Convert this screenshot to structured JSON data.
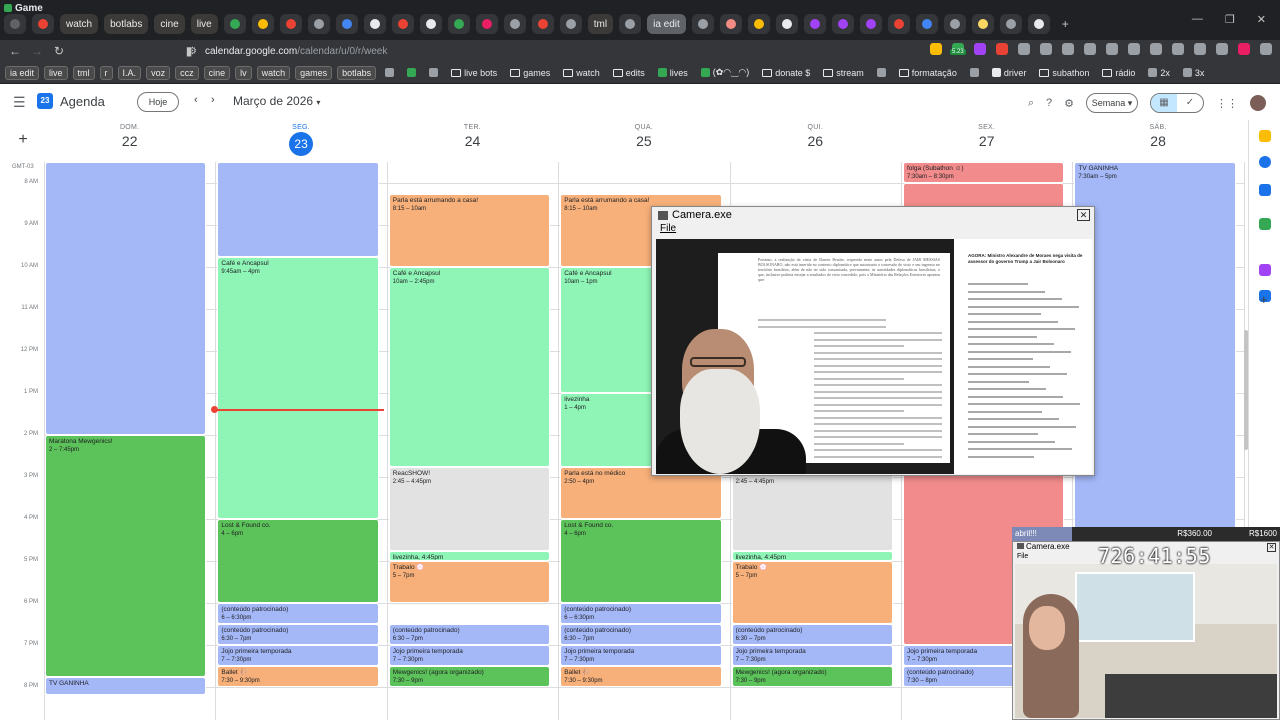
{
  "browser": {
    "window_title": "Game",
    "tabs": [
      {
        "label": "",
        "color": "#5f6368"
      },
      {
        "label": "",
        "color": "#ea4335"
      },
      {
        "label": "watch",
        "color": "#e8eaed"
      },
      {
        "label": "botlabs",
        "color": "#e8eaed"
      },
      {
        "label": "cine",
        "color": "#e8eaed"
      },
      {
        "label": "live",
        "color": "#e8eaed"
      },
      {
        "label": "",
        "color": "#34a853"
      },
      {
        "label": "",
        "color": "#fbbc04"
      },
      {
        "label": "",
        "color": "#ea4335"
      },
      {
        "label": "",
        "color": "#9aa0a6"
      },
      {
        "label": "",
        "color": "#4285f4"
      },
      {
        "label": "",
        "color": "#e8eaed"
      },
      {
        "label": "",
        "color": "#ea4335"
      },
      {
        "label": "",
        "color": "#e8eaed"
      },
      {
        "label": "",
        "color": "#34a853"
      },
      {
        "label": "",
        "color": "#e91e63"
      },
      {
        "label": "",
        "color": "#9aa0a6"
      },
      {
        "label": "",
        "color": "#ea4335"
      },
      {
        "label": "",
        "color": "#9aa0a6"
      },
      {
        "label": "tml",
        "color": "#e8eaed"
      },
      {
        "label": "",
        "color": "#9aa0a6"
      },
      {
        "label": "ia edit",
        "color": "#e8eaed"
      },
      {
        "label": "",
        "color": "#9aa0a6"
      },
      {
        "label": "",
        "color": "#f28b82"
      },
      {
        "label": "",
        "color": "#fbbc04"
      },
      {
        "label": "",
        "color": "#e8eaed"
      },
      {
        "label": "",
        "color": "#a142f4"
      },
      {
        "label": "",
        "color": "#a142f4"
      },
      {
        "label": "",
        "color": "#a142f4"
      },
      {
        "label": "",
        "color": "#ea4335"
      },
      {
        "label": "",
        "color": "#4285f4"
      },
      {
        "label": "",
        "color": "#9aa0a6"
      },
      {
        "label": "",
        "color": "#fdd663"
      },
      {
        "label": "",
        "color": "#9aa0a6"
      },
      {
        "label": "",
        "color": "#e8eaed"
      }
    ],
    "new_tab": "+",
    "url_host": "calendar.google.com",
    "url_path": "/calendar/u/0/r/week",
    "extension_badge": "5.23",
    "window_controls": [
      "—",
      "❐",
      "✕"
    ],
    "bookmarks": [
      {
        "label": "ia edit",
        "boxed": true
      },
      {
        "label": "live",
        "boxed": true
      },
      {
        "label": "tml",
        "boxed": true
      },
      {
        "label": "r",
        "boxed": true
      },
      {
        "label": "I.A.",
        "boxed": true
      },
      {
        "label": "voz",
        "boxed": true
      },
      {
        "label": "ccz",
        "boxed": true
      },
      {
        "label": "cine",
        "boxed": true
      },
      {
        "label": "lv",
        "boxed": true
      },
      {
        "label": "watch",
        "boxed": true
      },
      {
        "label": "games",
        "boxed": true
      },
      {
        "label": "botlabs",
        "boxed": true
      },
      {
        "label": "",
        "boxed": false,
        "icon": "grid-icon"
      },
      {
        "label": "",
        "boxed": false,
        "icon": "sheet-icon"
      },
      {
        "label": "",
        "boxed": false,
        "icon": "globe-icon"
      },
      {
        "label": "live bots",
        "boxed": false,
        "icon": "folder-icon"
      },
      {
        "label": "games",
        "boxed": false,
        "icon": "folder-icon"
      },
      {
        "label": "watch",
        "boxed": false,
        "icon": "folder-icon"
      },
      {
        "label": "edits",
        "boxed": false,
        "icon": "folder-icon"
      },
      {
        "label": "lives",
        "boxed": false,
        "icon": "sheet-icon"
      },
      {
        "label": "(✿◠‿◠)",
        "boxed": false,
        "icon": "leaf-icon"
      },
      {
        "label": "donate $",
        "boxed": false,
        "icon": "folder-icon"
      },
      {
        "label": "stream",
        "boxed": false,
        "icon": "folder-icon"
      },
      {
        "label": "",
        "boxed": false,
        "icon": "screen-icon"
      },
      {
        "label": "formatação",
        "boxed": false,
        "icon": "folder-icon"
      },
      {
        "label": "",
        "boxed": false,
        "icon": "globe-icon"
      },
      {
        "label": "driver",
        "boxed": false,
        "icon": "doc-icon"
      },
      {
        "label": "subathon",
        "boxed": false,
        "icon": "folder-icon"
      },
      {
        "label": "rádio",
        "boxed": false,
        "icon": "folder-icon"
      },
      {
        "label": "2x",
        "boxed": false,
        "icon": "globe-icon"
      },
      {
        "label": "3x",
        "boxed": false,
        "icon": "globe-icon"
      }
    ]
  },
  "calendar": {
    "app_title": "Agenda",
    "logo_text": "23",
    "today_button": "Hoje",
    "month_label": "Março de 2026",
    "view_button": "Semana",
    "timezone": "GMT-03",
    "days": [
      {
        "dow": "DOM.",
        "num": "22",
        "today": false
      },
      {
        "dow": "SEG.",
        "num": "23",
        "today": true
      },
      {
        "dow": "TER.",
        "num": "24",
        "today": false
      },
      {
        "dow": "QUA.",
        "num": "25",
        "today": false
      },
      {
        "dow": "QUI.",
        "num": "26",
        "today": false
      },
      {
        "dow": "SEX.",
        "num": "27",
        "today": false
      },
      {
        "dow": "SÁB.",
        "num": "28",
        "today": false
      }
    ],
    "hours": [
      "8 AM",
      "9 AM",
      "10 AM",
      "11 AM",
      "12 PM",
      "1 PM",
      "2 PM",
      "3 PM",
      "4 PM",
      "5 PM",
      "6 PM",
      "7 PM",
      "8 PM"
    ],
    "events": [
      {
        "day": 0,
        "start": 7.5,
        "end": 14.0,
        "title": "",
        "time": "",
        "color": "blue"
      },
      {
        "day": 0,
        "start": 14.0,
        "end": 19.75,
        "title": "Maratona Mewgenics!",
        "time": "2 – 7:45pm",
        "color": "dgreen"
      },
      {
        "day": 0,
        "start": 19.75,
        "end": 20.2,
        "title": "TV GANINHA",
        "time": "",
        "color": "blue"
      },
      {
        "day": 1,
        "start": 7.5,
        "end": 9.75,
        "title": "",
        "time": "",
        "color": "blue"
      },
      {
        "day": 1,
        "start": 9.75,
        "end": 16.0,
        "title": "Café e Ancapsul",
        "time": "9:45am – 4pm",
        "color": "mint"
      },
      {
        "day": 1,
        "start": 16.0,
        "end": 18.0,
        "title": "Lost & Found co.",
        "time": "4 – 6pm",
        "color": "dgreen"
      },
      {
        "day": 1,
        "start": 18.0,
        "end": 18.5,
        "title": "(conteúdo patrocinado)",
        "time": "6 – 6:30pm",
        "color": "blue"
      },
      {
        "day": 1,
        "start": 18.5,
        "end": 19.0,
        "title": "(conteúdo patrocinado)",
        "time": "6:30 – 7pm",
        "color": "blue"
      },
      {
        "day": 1,
        "start": 19.0,
        "end": 19.5,
        "title": "Jojo primeira temporada",
        "time": "7 – 7:30pm",
        "color": "blue"
      },
      {
        "day": 1,
        "start": 19.5,
        "end": 20.0,
        "title": "Ballet 🩰",
        "time": "7:30 – 9:30pm",
        "color": "orange"
      },
      {
        "day": 2,
        "start": 8.25,
        "end": 10.0,
        "title": "Parla está arrumando a casa!",
        "time": "8:15 – 10am",
        "color": "orange"
      },
      {
        "day": 2,
        "start": 10.0,
        "end": 14.75,
        "title": "Café e Ancapsul",
        "time": "10am – 2:45pm",
        "color": "mint"
      },
      {
        "day": 2,
        "start": 14.75,
        "end": 16.75,
        "title": "ReacSHOW!",
        "time": "2:45 – 4:45pm",
        "color": "gray"
      },
      {
        "day": 2,
        "start": 16.75,
        "end": 17.0,
        "title": "livezinha, 4:45pm",
        "time": "",
        "color": "mint"
      },
      {
        "day": 2,
        "start": 17.0,
        "end": 18.0,
        "title": "Trabalo 💮",
        "time": "5 – 7pm",
        "color": "orange"
      },
      {
        "day": 2,
        "start": 18.5,
        "end": 19.0,
        "title": "(conteúdo patrocinado)",
        "time": "6:30 – 7pm",
        "color": "blue"
      },
      {
        "day": 2,
        "start": 19.0,
        "end": 19.5,
        "title": "Jojo primeira temporada",
        "time": "7 – 7:30pm",
        "color": "blue"
      },
      {
        "day": 2,
        "start": 19.5,
        "end": 20.0,
        "title": "Mewgenics! (agora organizado)",
        "time": "7:30 – 9pm",
        "color": "dgreen"
      },
      {
        "day": 3,
        "start": 8.25,
        "end": 10.0,
        "title": "Parla está arrumando a casa!",
        "time": "8:15 – 10am",
        "color": "orange"
      },
      {
        "day": 3,
        "start": 10.0,
        "end": 13.0,
        "title": "Café e Ancapsul",
        "time": "10am – 1pm",
        "color": "mint"
      },
      {
        "day": 3,
        "start": 13.0,
        "end": 14.75,
        "title": "livezinha",
        "time": "1 – 4pm",
        "color": "mint"
      },
      {
        "day": 3,
        "start": 14.75,
        "end": 16.0,
        "title": "Parla está no médico",
        "time": "2:50 – 4pm",
        "color": "orange"
      },
      {
        "day": 3,
        "start": 16.0,
        "end": 18.0,
        "title": "Lost & Found co.",
        "time": "4 – 6pm",
        "color": "dgreen"
      },
      {
        "day": 3,
        "start": 18.0,
        "end": 18.5,
        "title": "(conteúdo patrocinado)",
        "time": "6 – 6:30pm",
        "color": "blue"
      },
      {
        "day": 3,
        "start": 18.5,
        "end": 19.0,
        "title": "(conteúdo patrocinado)",
        "time": "6:30 – 7pm",
        "color": "blue"
      },
      {
        "day": 3,
        "start": 19.0,
        "end": 19.5,
        "title": "Jojo primeira temporada",
        "time": "7 – 7:30pm",
        "color": "blue"
      },
      {
        "day": 3,
        "start": 19.5,
        "end": 20.0,
        "title": "Ballet 🩰",
        "time": "7:30 – 9:30pm",
        "color": "orange"
      },
      {
        "day": 4,
        "start": 14.75,
        "end": 16.75,
        "title": "ReacSHOW!",
        "time": "2:45 – 4:45pm",
        "color": "gray"
      },
      {
        "day": 4,
        "start": 16.75,
        "end": 17.0,
        "title": "livezinha, 4:45pm",
        "time": "",
        "color": "mint"
      },
      {
        "day": 4,
        "start": 17.0,
        "end": 18.5,
        "title": "Trabalo 💮",
        "time": "5 – 7pm",
        "color": "orange"
      },
      {
        "day": 4,
        "start": 18.5,
        "end": 19.0,
        "title": "(conteúdo patrocinado)",
        "time": "6:30 – 7pm",
        "color": "blue"
      },
      {
        "day": 4,
        "start": 19.0,
        "end": 19.5,
        "title": "Jojo primeira temporada",
        "time": "7 – 7:30pm",
        "color": "blue"
      },
      {
        "day": 4,
        "start": 19.5,
        "end": 20.0,
        "title": "Mewgenics! (agora organizado)",
        "time": "7:30 – 9pm",
        "color": "dgreen"
      },
      {
        "day": 5,
        "start": 7.5,
        "end": 8.0,
        "title": "folga (Subathon ☺)",
        "time": "7:30am – 8:30pm",
        "color": "red"
      },
      {
        "day": 5,
        "start": 8.0,
        "end": 19.0,
        "title": "",
        "time": "",
        "color": "red"
      },
      {
        "day": 5,
        "start": 19.0,
        "end": 19.5,
        "title": "Jojo primeira temporada",
        "time": "7 – 7:30pm",
        "color": "blue"
      },
      {
        "day": 5,
        "start": 19.5,
        "end": 20.0,
        "title": "(conteúdo patrocinado)",
        "time": "7:30 – 8pm",
        "color": "blue"
      },
      {
        "day": 6,
        "start": 7.5,
        "end": 16.5,
        "title": "TV GANINHA",
        "time": "7:30am – 5pm",
        "color": "blue"
      }
    ]
  },
  "camera_window": {
    "title": "Camera.exe",
    "menu_file": "File",
    "close": "✕",
    "doc_paragraph": "Portanto, a realização da visita de Darren Beattie, requerida neste autos pela Defesa de JAIR MESSIAS BOLSONARO, não está inserida no contexto diplomático que autorizaria a concessão do visto e seu ingresso no território brasileiro, além de não ter sido comunicada, previamente, às autoridades diplomáticas brasileiras, o que, inclusive poderia ensejar a resultados do visto concedido, pois o Ministério das Relações Exteriores apontou que:",
    "tweet_header": "AGORA: Ministro Alexandre de Moraes nega visita de assessor do governo Trump a Jair Bolsonaro"
  },
  "overlay": {
    "label": "abril!!!",
    "amount": "R$360.00",
    "goal": "R$1600",
    "timer": "726:41:55",
    "cam_title": "Camera.exe",
    "cam_menu": "File",
    "cam_close": "✕"
  }
}
